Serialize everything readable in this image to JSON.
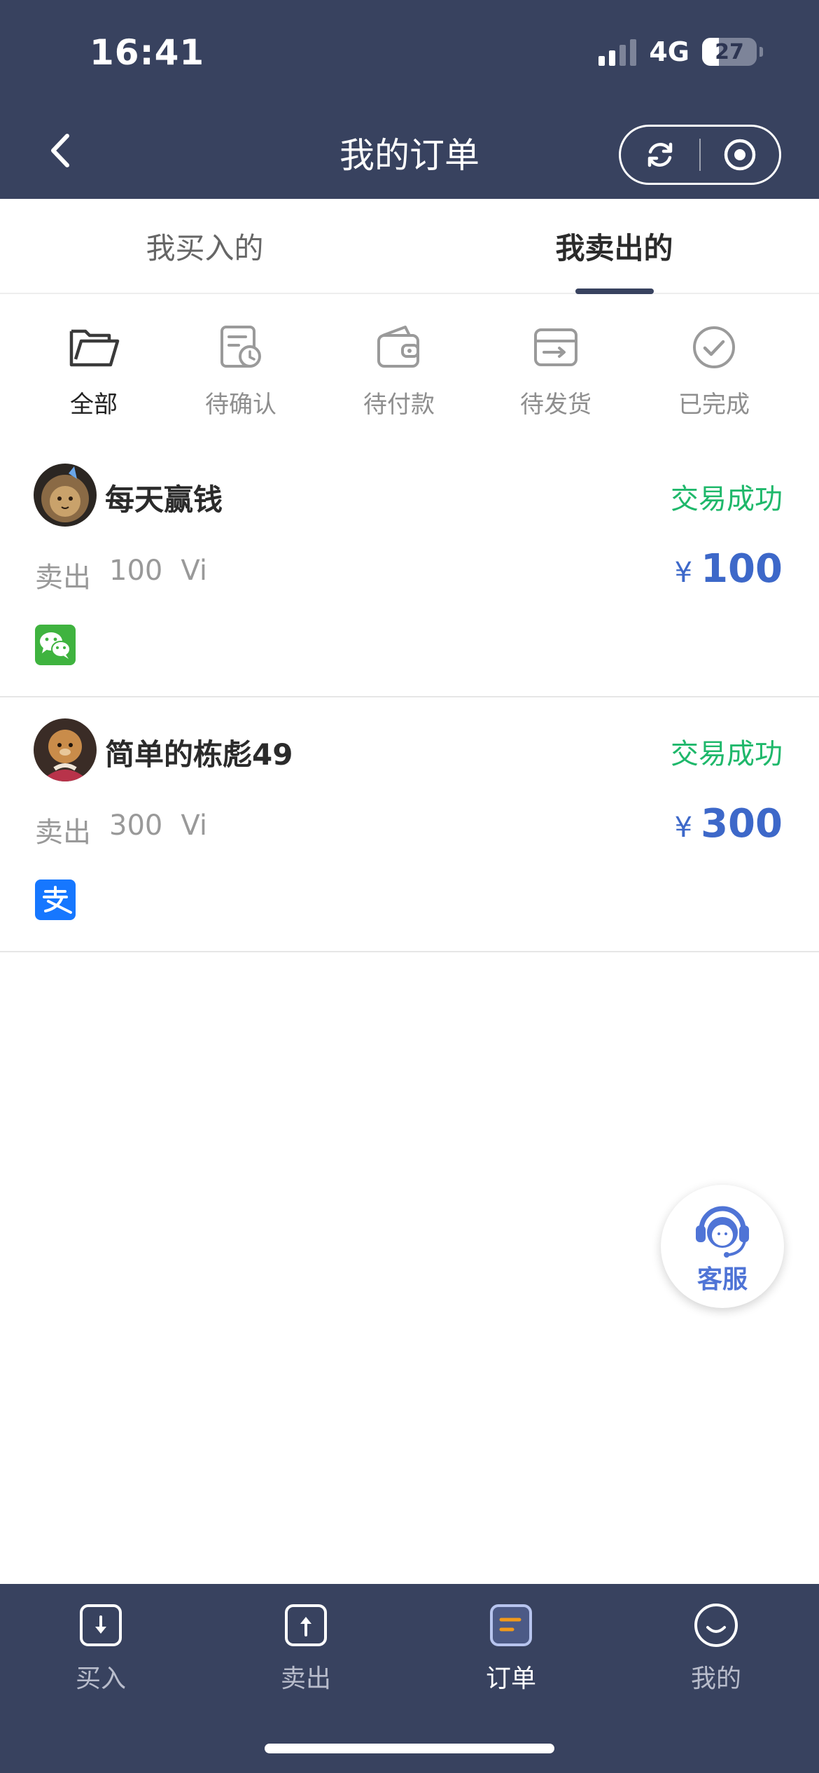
{
  "status_bar": {
    "time": "16:41",
    "network": "4G",
    "battery": "27"
  },
  "header": {
    "title": "我的订单"
  },
  "tabs": [
    {
      "label": "我买入的",
      "active": false
    },
    {
      "label": "我卖出的",
      "active": true
    }
  ],
  "filters": [
    {
      "label": "全部",
      "icon": "folder-icon",
      "active": true
    },
    {
      "label": "待确认",
      "icon": "document-clock-icon",
      "active": false
    },
    {
      "label": "待付款",
      "icon": "wallet-icon",
      "active": false
    },
    {
      "label": "待发货",
      "icon": "shipping-box-icon",
      "active": false
    },
    {
      "label": "已完成",
      "icon": "check-circle-icon",
      "active": false
    }
  ],
  "orders": [
    {
      "username": "每天赢钱",
      "status": "交易成功",
      "action": "卖出",
      "quantity": "100",
      "unit": "Vi",
      "currency": "¥",
      "price": "100",
      "payment": "wechat-pay-icon"
    },
    {
      "username": "简单的栋彪49",
      "status": "交易成功",
      "action": "卖出",
      "quantity": "300",
      "unit": "Vi",
      "currency": "¥",
      "price": "300",
      "payment": "alipay-icon"
    }
  ],
  "customer_service": {
    "label": "客服"
  },
  "bottom_nav": [
    {
      "label": "买入",
      "icon": "download-box-icon",
      "active": false
    },
    {
      "label": "卖出",
      "icon": "upload-box-icon",
      "active": false
    },
    {
      "label": "订单",
      "icon": "order-list-icon",
      "active": true
    },
    {
      "label": "我的",
      "icon": "smile-icon",
      "active": false
    }
  ],
  "colors": {
    "header_bg": "#38425f",
    "success_green": "#1fb86b",
    "price_blue": "#3d68c9",
    "wechat_green": "#3fb33f",
    "alipay_blue": "#1677ff",
    "accent_orange": "#f29a1a"
  }
}
